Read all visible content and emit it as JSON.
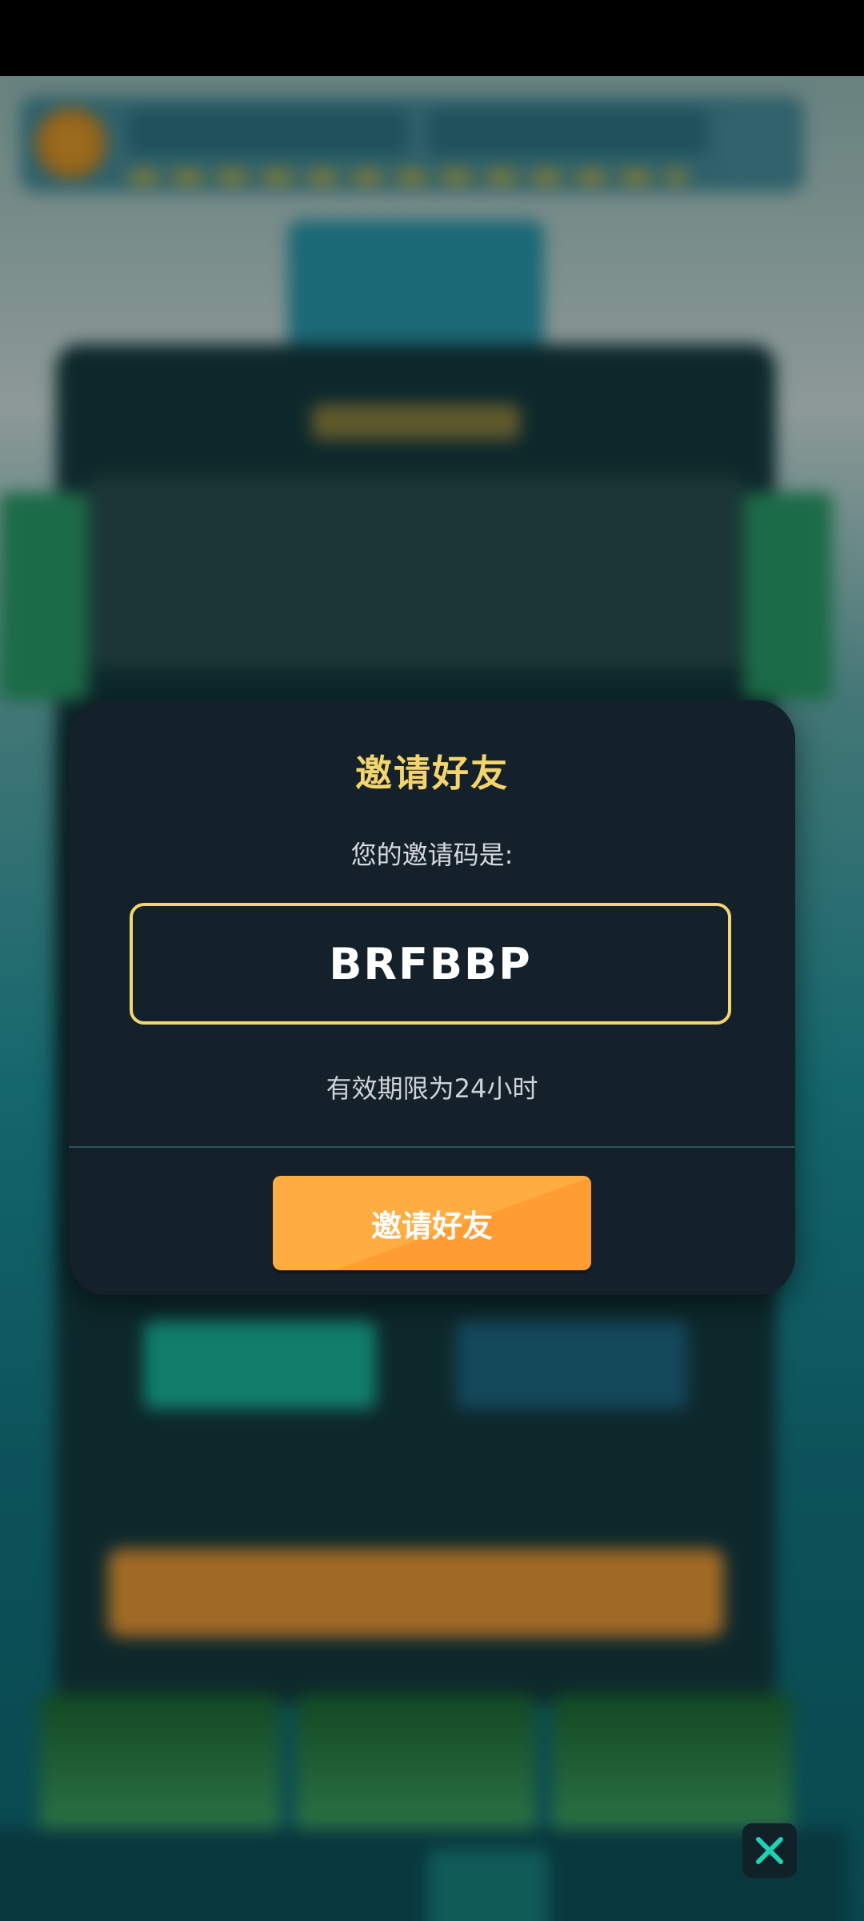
{
  "dialog": {
    "title": "邀请好友",
    "subtitle": "您的邀请码是:",
    "code": "BRFBBP",
    "validity": "有效期限为24小时",
    "button_label": "邀请好友"
  },
  "colors": {
    "accent_gold": "#f4d46b",
    "button_orange": "#ffad43",
    "modal_bg": "#14202a",
    "close_icon": "#1ed1b5"
  },
  "icons": [
    "close-icon"
  ]
}
